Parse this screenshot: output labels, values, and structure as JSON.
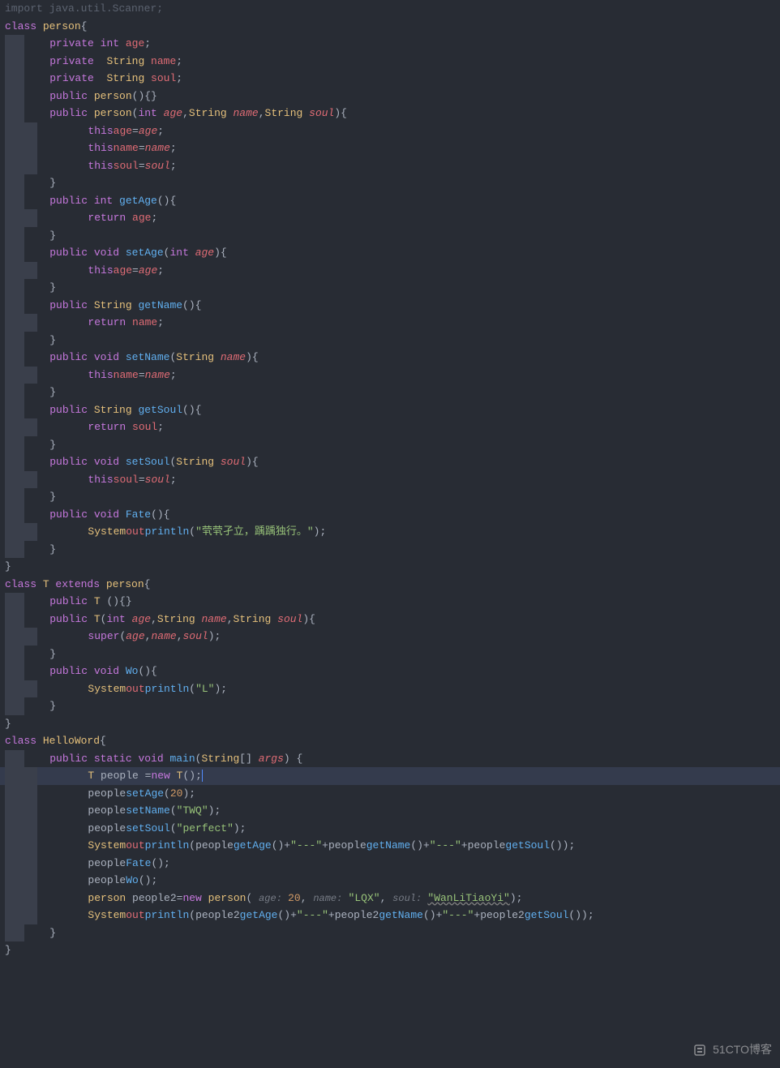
{
  "watermark": "51CTO博客",
  "code": {
    "l1": {
      "import": "import",
      "pkg": " java.util.",
      "scanner": "Scanner",
      "semi": ";"
    },
    "l2": {
      "class": "class ",
      "name": "person",
      "brace": "{"
    },
    "l3": {
      "priv": "private ",
      "int": "int ",
      "f": "age",
      ";": ";"
    },
    "l4": {
      "priv": "private  ",
      "String": "String ",
      "f": "name",
      ";": ";"
    },
    "l5": {
      "priv": "private  ",
      "String": "String ",
      "f": "soul",
      ";": ";"
    },
    "l6": {
      "pub": "public ",
      "cname": "person",
      "p": "(){}"
    },
    "l7": {
      "pub": "public ",
      "cname": "person",
      "op": "(",
      "int": "int ",
      "p1": "age",
      "c1": ",",
      "String": "String ",
      "p2": "name",
      "c2": ",",
      "String2": "String ",
      "p3": "soul",
      "cp": "){"
    },
    "l8": {
      "this": "this",
      ".": ".",
      "f": "age",
      "eq": "=",
      "v": "age",
      ";": ";"
    },
    "l9": {
      "this": "this",
      ".": ".",
      "f": "name",
      "eq": "=",
      "v": "name",
      ";": ";"
    },
    "l10": {
      "this": "this",
      ".": ".",
      "f": "soul",
      "eq": "=",
      "v": "soul",
      ";": ";"
    },
    "l11": {
      "b": "}"
    },
    "l12": {
      "pub": "public ",
      "int": "int ",
      "m": "getAge",
      "p": "(){"
    },
    "l13": {
      "ret": "return ",
      "f": "age",
      ";": ";"
    },
    "l14": {
      "b": "}"
    },
    "l15": {
      "pub": "public ",
      "void": "void ",
      "m": "setAge",
      "op": "(",
      "int": "int ",
      "p": "age",
      "cp": "){"
    },
    "l16": {
      "this": "this",
      ".": ".",
      "f": "age",
      "eq": "=",
      "v": "age",
      ";": ";"
    },
    "l17": {
      "b": "}"
    },
    "l18": {
      "pub": "public ",
      "String": "String ",
      "m": "getName",
      "p": "(){"
    },
    "l19": {
      "ret": "return ",
      "f": "name",
      ";": ";"
    },
    "l20": {
      "b": "}"
    },
    "l21": {
      "pub": "public ",
      "void": "void ",
      "m": "setName",
      "op": "(",
      "String": "String ",
      "p": "name",
      "cp": "){"
    },
    "l22": {
      "this": "this",
      ".": ".",
      "f": "name",
      "eq": "=",
      "v": "name",
      ";": ";"
    },
    "l23": {
      "b": "}"
    },
    "l24": {
      "pub": "public ",
      "String": "String ",
      "m": "getSoul",
      "p": "(){"
    },
    "l25": {
      "ret": "return ",
      "f": "soul",
      ";": ";"
    },
    "l26": {
      "b": "}"
    },
    "l27": {
      "pub": "public ",
      "void": "void ",
      "m": "setSoul",
      "op": "(",
      "String": "String ",
      "p": "soul",
      "cp": "){"
    },
    "l28": {
      "this": "this",
      ".": ".",
      "f": "soul",
      "eq": "=",
      "v": "soul",
      ";": ";"
    },
    "l29": {
      "b": "}"
    },
    "l30": {
      "pub": "public ",
      "void": "void ",
      "m": "Fate",
      "p": "(){"
    },
    "l31": {
      "sys": "System",
      ".": ".",
      "out": "out",
      ".2": ".",
      "pl": "println",
      "op": "(",
      "s": "\"茕茕孑立，踽踽独行。\"",
      "cp": ");"
    },
    "l32": {
      "b": "}"
    },
    "l33": {
      "b": "}"
    },
    "l34": {
      "class": "class ",
      "name": "T ",
      "ext": "extends ",
      "sup": "person",
      "b": "{"
    },
    "l35": {
      "pub": "public ",
      "cname": "T ",
      "p": "(){}"
    },
    "l36": {
      "pub": "public ",
      "cname": "T",
      "op": "(",
      "int": "int ",
      "p1": "age",
      "c1": ",",
      "String": "String ",
      "p2": "name",
      "c2": ",",
      "String2": "String ",
      "p3": "soul",
      "cp": "){"
    },
    "l37": {
      "super": "super",
      "op": "(",
      "p1": "age",
      "c1": ",",
      "p2": "name",
      "c2": ",",
      "p3": "soul",
      "cp": ");"
    },
    "l38": {
      "b": "}"
    },
    "l39": {
      "pub": "public ",
      "void": "void ",
      "m": "Wo",
      "p": "(){"
    },
    "l40": {
      "sys": "System",
      ".": ".",
      "out": "out",
      ".2": ".",
      "pl": "println",
      "op": "(",
      "s": "\"L\"",
      "cp": ");"
    },
    "l41": {
      "b": "}"
    },
    "l42": {
      "b": "}"
    },
    "l43": {
      "class": "class ",
      "name": "HelloWord",
      "b": "{"
    },
    "l44": {
      "pub": "public ",
      "static": "static ",
      "void": "void ",
      "m": "main",
      "op": "(",
      "String": "String",
      "arr": "[] ",
      "p": "args",
      "cp": ") {"
    },
    "l45": {
      "T": "T ",
      "var": "people ",
      "eq": "=",
      "new": "new ",
      "T2": "T",
      "p": "();"
    },
    "l46": {
      "var": "people",
      ".": ".",
      "m": "setAge",
      "op": "(",
      "n": "20",
      "cp": ");"
    },
    "l47": {
      "var": "people",
      ".": ".",
      "m": "setName",
      "op": "(",
      "s": "\"TWQ\"",
      "cp": ");"
    },
    "l48": {
      "var": "people",
      ".": ".",
      "m": "setSoul",
      "op": "(",
      "s": "\"perfect\"",
      "cp": ");"
    },
    "l49": {
      "sys": "System",
      ".": ".",
      "out": "out",
      ".2": ".",
      "pl": "println",
      "op": "(",
      "var": "people",
      ".3": ".",
      "m1": "getAge",
      "p1": "()",
      "plus": "+",
      "s1": "\"---\"",
      "plus2": "+",
      "var2": "people",
      ".4": ".",
      "m2": "getName",
      "p2": "()",
      "plus3": "+",
      "s2": "\"---\"",
      "plus4": "+",
      "var3": "people",
      ".5": ".",
      "m3": "getSoul",
      "p3": "()",
      "cp": ");"
    },
    "l50": {
      "var": "people",
      ".": ".",
      "m": "Fate",
      "p": "();"
    },
    "l51": {
      "var": "people",
      ".": ".",
      "m": "Wo",
      "p": "();"
    },
    "l52": {
      "cls": "person ",
      "var": "people2",
      "eq": "=",
      "new": "new ",
      "cls2": "person",
      "op": "( ",
      "h1": "age: ",
      "n": "20",
      "c1": ", ",
      "h2": "name: ",
      "s1": "\"LQX\"",
      "c2": ", ",
      "h3": "soul: ",
      "s2": "\"WanLiTiaoYi\"",
      "cp": ");"
    },
    "l53": {
      "sys": "System",
      ".": ".",
      "out": "out",
      ".2": ".",
      "pl": "println",
      "op": "(",
      "var": "people2",
      ".3": ".",
      "m1": "getAge",
      "p1": "()",
      "plus": "+",
      "s1": "\"---\"",
      "plus2": "+",
      "var2": "people2",
      ".4": ".",
      "m2": "getName",
      "p2": "()",
      "plus3": "+",
      "s2": "\"---\"",
      "plus4": "+",
      "var3": "people2",
      ".5": ".",
      "m3": "getSoul",
      "p3": "()",
      "cp": ");"
    },
    "l54": {
      "b": "}"
    },
    "l55": {
      "b": "}"
    }
  }
}
